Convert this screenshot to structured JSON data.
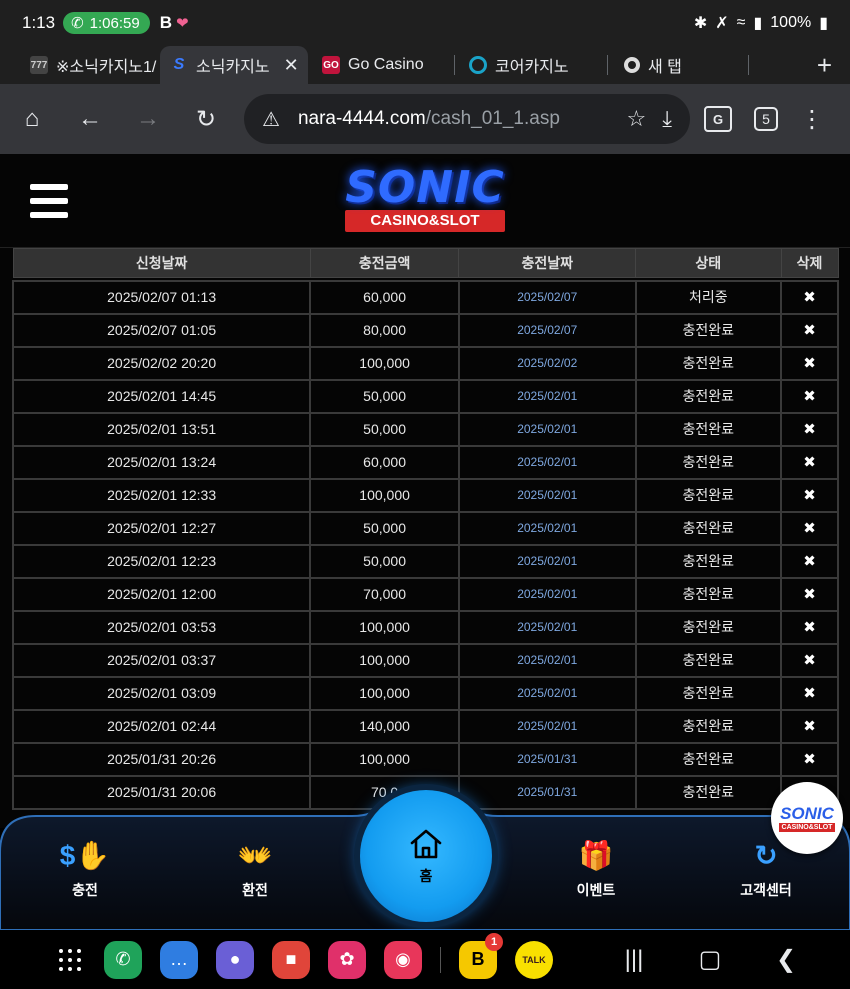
{
  "status_bar": {
    "time": "1:13",
    "call_duration": "1:06:59",
    "battery": "100%"
  },
  "tabs": [
    {
      "title": "※소닉카지노1/",
      "active": false
    },
    {
      "title": "소닉카지노",
      "active": true
    },
    {
      "title": "Go Casino",
      "active": false
    },
    {
      "title": "코어카지노",
      "active": false
    },
    {
      "title": "새 탭",
      "active": false
    }
  ],
  "toolbar": {
    "url_domain": "nara-4444.com",
    "url_path": "/cash_01_1.asp",
    "tab_count": "5"
  },
  "site": {
    "logo_text": "SONIC",
    "logo_sub": "CASINO&SLOT"
  },
  "table": {
    "headers": [
      "신청날짜",
      "충전금액",
      "충전날짜",
      "상태",
      "삭제"
    ],
    "rows": [
      [
        "2025/02/07 01:13",
        "60,000",
        "2025/02/07",
        "처리중",
        "✖"
      ],
      [
        "2025/02/07 01:05",
        "80,000",
        "2025/02/07",
        "충전완료",
        "✖"
      ],
      [
        "2025/02/02 20:20",
        "100,000",
        "2025/02/02",
        "충전완료",
        "✖"
      ],
      [
        "2025/02/01 14:45",
        "50,000",
        "2025/02/01",
        "충전완료",
        "✖"
      ],
      [
        "2025/02/01 13:51",
        "50,000",
        "2025/02/01",
        "충전완료",
        "✖"
      ],
      [
        "2025/02/01 13:24",
        "60,000",
        "2025/02/01",
        "충전완료",
        "✖"
      ],
      [
        "2025/02/01 12:33",
        "100,000",
        "2025/02/01",
        "충전완료",
        "✖"
      ],
      [
        "2025/02/01 12:27",
        "50,000",
        "2025/02/01",
        "충전완료",
        "✖"
      ],
      [
        "2025/02/01 12:23",
        "50,000",
        "2025/02/01",
        "충전완료",
        "✖"
      ],
      [
        "2025/02/01 12:00",
        "70,000",
        "2025/02/01",
        "충전완료",
        "✖"
      ],
      [
        "2025/02/01 03:53",
        "100,000",
        "2025/02/01",
        "충전완료",
        "✖"
      ],
      [
        "2025/02/01 03:37",
        "100,000",
        "2025/02/01",
        "충전완료",
        "✖"
      ],
      [
        "2025/02/01 03:09",
        "100,000",
        "2025/02/01",
        "충전완료",
        "✖"
      ],
      [
        "2025/02/01 02:44",
        "140,000",
        "2025/02/01",
        "충전완료",
        "✖"
      ],
      [
        "2025/01/31 20:26",
        "100,000",
        "2025/01/31",
        "충전완료",
        "✖"
      ],
      [
        "2025/01/31 20:06",
        "70,0",
        "2025/01/31",
        "충전완료",
        ""
      ]
    ]
  },
  "bottom_nav": {
    "deposit": "충전",
    "withdraw": "환전",
    "home": "홈",
    "event": "이벤트",
    "support": "고객센터"
  },
  "floating_logo": {
    "text": "SONIC",
    "sub": "CASINO&SLOT"
  },
  "sysbar": {
    "badge_count": "1",
    "talk_label": "TALK"
  },
  "colors": {
    "accent_blue": "#139cf0",
    "nav_icon_blue": "#3aa0ff",
    "logo_red": "#d62828",
    "date_link_blue": "#7fa8e0"
  }
}
